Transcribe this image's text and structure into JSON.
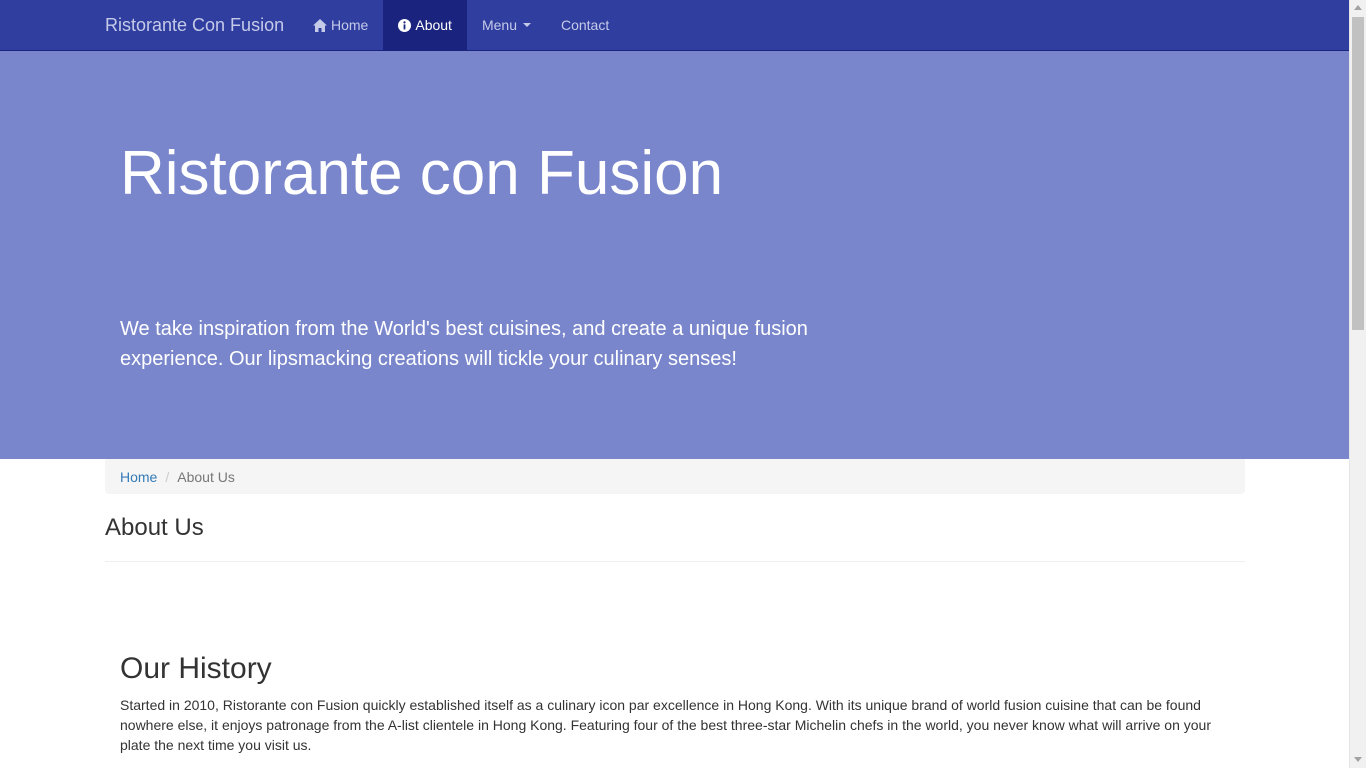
{
  "navbar": {
    "brand": "Ristorante Con Fusion",
    "items": [
      {
        "label": "Home",
        "icon": "home-icon",
        "active": false
      },
      {
        "label": "About",
        "icon": "info-icon",
        "active": true
      },
      {
        "label": "Menu",
        "icon": "caret-down-icon",
        "active": false
      },
      {
        "label": "Contact",
        "active": false
      }
    ],
    "colors": {
      "background": "#303f9f",
      "active": "#1a237e"
    }
  },
  "hero": {
    "title": "Ristorante con Fusion",
    "text": "We take inspiration from the World's best cuisines, and create a unique fusion experience. Our lipsmacking creations will tickle your culinary senses!",
    "background": "#7986cb"
  },
  "breadcrumb": {
    "items": [
      "Home",
      "About Us"
    ]
  },
  "page": {
    "title": "About Us"
  },
  "history": {
    "title": "Our History",
    "text": "Started in 2010, Ristorante con Fusion quickly established itself as a culinary icon par excellence in Hong Kong. With its unique brand of world fusion cuisine that can be found nowhere else, it enjoys patronage from the A-list clientele in Hong Kong. Featuring four of the best three-star Michelin chefs in the world, you never know what will arrive on your plate the next time you visit us."
  }
}
